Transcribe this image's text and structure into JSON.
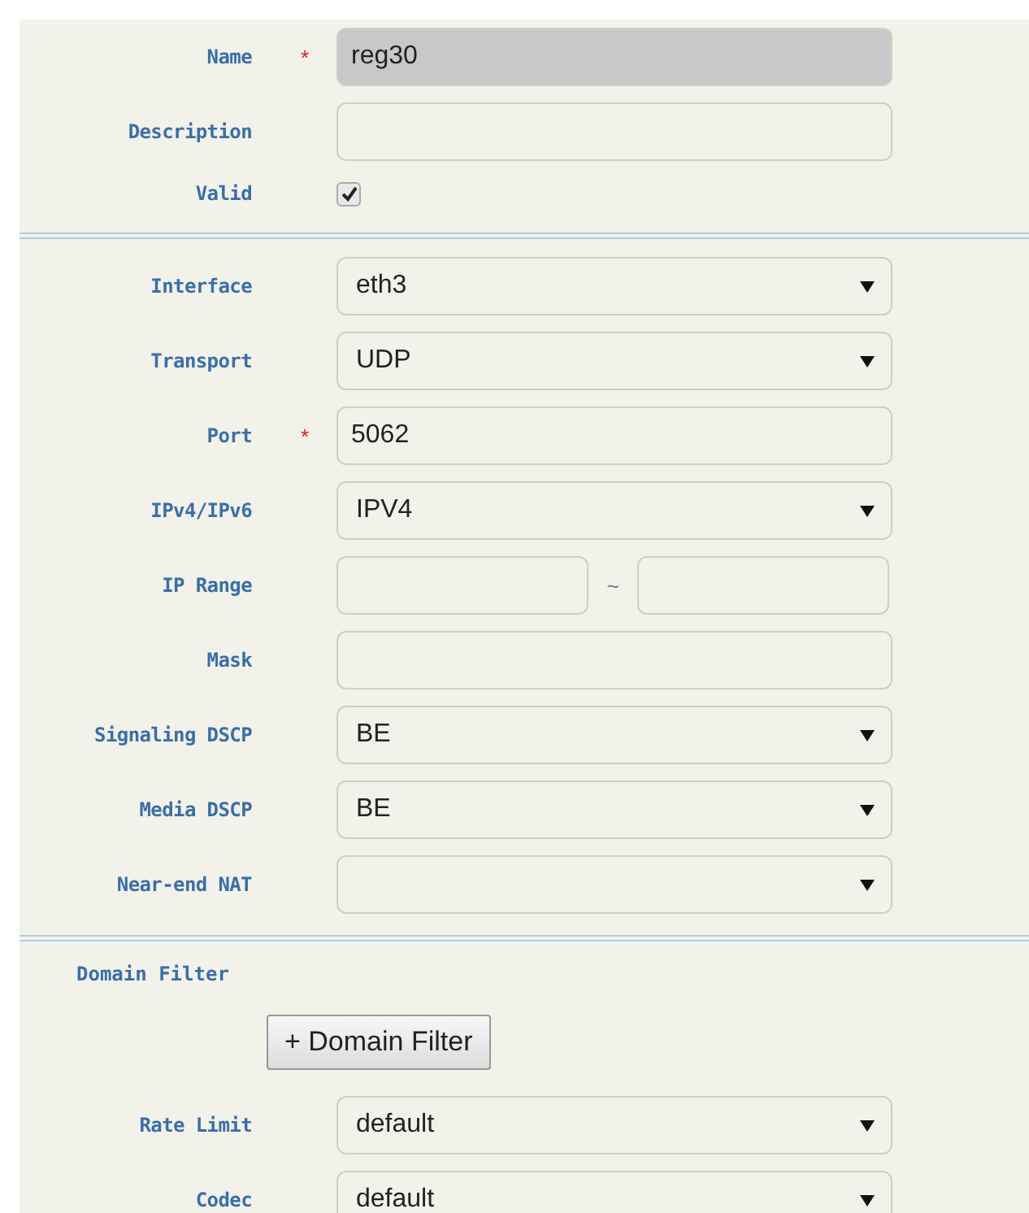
{
  "sections": [
    {
      "rows": [
        {
          "kind": "text",
          "label": "Name",
          "required_mark": "*",
          "value": "reg30",
          "disabled": true
        },
        {
          "kind": "text",
          "label": "Description",
          "value": "",
          "disabled": false
        },
        {
          "kind": "checkbox",
          "label": "Valid",
          "checked": true
        }
      ]
    },
    {
      "rows": [
        {
          "kind": "select",
          "label": "Interface",
          "value": "eth3"
        },
        {
          "kind": "select",
          "label": "Transport",
          "value": "UDP"
        },
        {
          "kind": "text",
          "label": "Port",
          "required_mark": "*",
          "value": "5062",
          "disabled": false
        },
        {
          "kind": "select",
          "label": "IPv4/IPv6",
          "value": "IPV4"
        },
        {
          "kind": "range",
          "label": "IP Range",
          "separator": "~"
        },
        {
          "kind": "text",
          "label": "Mask",
          "value": "",
          "disabled": false
        },
        {
          "kind": "select",
          "label": "Signaling DSCP",
          "value": "BE"
        },
        {
          "kind": "select",
          "label": "Media DSCP",
          "value": "BE"
        },
        {
          "kind": "select",
          "label": "Near-end NAT",
          "value": ""
        }
      ]
    },
    {
      "rows": [
        {
          "kind": "heading",
          "label": "Domain Filter"
        },
        {
          "kind": "button",
          "label": "+ Domain Filter"
        },
        {
          "kind": "select",
          "label": "Rate Limit",
          "value": "default"
        },
        {
          "kind": "select",
          "label": "Codec",
          "value": "default"
        }
      ]
    }
  ]
}
